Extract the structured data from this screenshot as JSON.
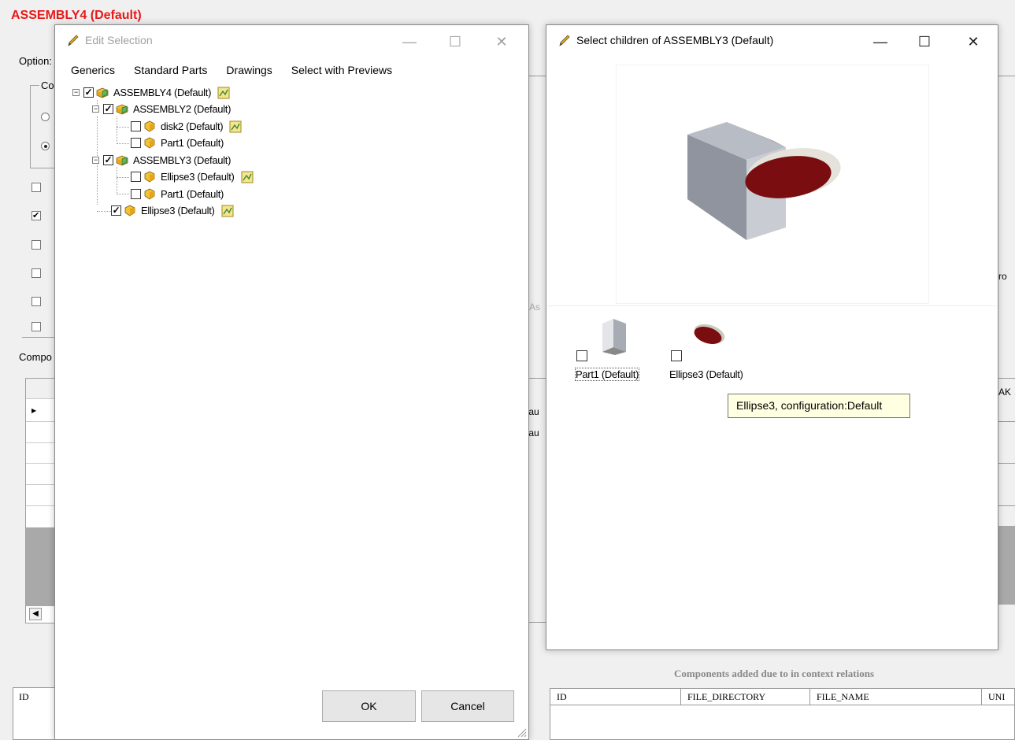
{
  "app": {
    "title": "ASSEMBLY4 (Default)",
    "options_label": "Option:",
    "group_label": "Co",
    "components_label": "Compo",
    "left_table_col": "ID",
    "mid_fragments": [
      "rAs",
      "fau",
      "fau",
      ")"
    ],
    "right_fragments": [
      "ro",
      "AK"
    ],
    "components_added_label": "Components added due to in context relations",
    "right_table_cols": [
      "ID",
      "FILE_DIRECTORY",
      "FILE_NAME",
      "UNI"
    ]
  },
  "edit_selection": {
    "title": "Edit Selection",
    "menu": [
      "Generics",
      "Standard Parts",
      "Drawings",
      "Select with Previews"
    ],
    "tree": [
      {
        "label": "ASSEMBLY4 (Default)",
        "checked": true,
        "type": "assembly",
        "expander": "minus",
        "drawing": true
      },
      {
        "label": "ASSEMBLY2 (Default)",
        "checked": true,
        "type": "assembly",
        "expander": "minus",
        "drawing": false
      },
      {
        "label": "disk2 (Default)",
        "checked": false,
        "type": "part",
        "drawing": true
      },
      {
        "label": "Part1 (Default)",
        "checked": false,
        "type": "part",
        "drawing": false
      },
      {
        "label": "ASSEMBLY3 (Default)",
        "checked": true,
        "type": "assembly",
        "expander": "minus",
        "drawing": false
      },
      {
        "label": "Ellipse3 (Default)",
        "checked": false,
        "type": "part",
        "drawing": true
      },
      {
        "label": "Part1 (Default)",
        "checked": false,
        "type": "part",
        "drawing": false
      },
      {
        "label": "Ellipse3 (Default)",
        "checked": true,
        "type": "part",
        "drawing": true
      }
    ],
    "ok_label": "OK",
    "cancel_label": "Cancel"
  },
  "select_children": {
    "title": "Select children of ASSEMBLY3 (Default)",
    "thumbnails": [
      {
        "label": "Part1 (Default)",
        "checked": false
      },
      {
        "label": "Ellipse3 (Default)",
        "checked": false
      }
    ],
    "tooltip": "Ellipse3, configuration:Default"
  },
  "colors": {
    "title_red": "#e81919",
    "ellipse_red": "#8b0d0d",
    "part_gray": "#9aa0ac"
  }
}
